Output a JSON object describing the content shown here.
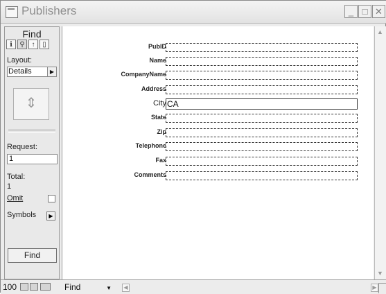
{
  "window": {
    "title": "Publishers",
    "icon": "document-icon"
  },
  "sidebar": {
    "heading": "Find",
    "mode_buttons": [
      "browse",
      "find",
      "layout",
      "preview"
    ],
    "layout_label": "Layout:",
    "layout_value": "Details",
    "request_label": "Request:",
    "request_value": "1",
    "total_label": "Total:",
    "total_value": "1",
    "omit_label": "Omit",
    "omit_checked": false,
    "symbols_label": "Symbols",
    "find_button": "Find"
  },
  "form": {
    "fields": [
      {
        "label": "PubID",
        "value": ""
      },
      {
        "label": "Name",
        "value": ""
      },
      {
        "label": "CompanyName",
        "value": ""
      },
      {
        "label": "Address",
        "value": ""
      },
      {
        "label": "City",
        "value": "CA"
      },
      {
        "label": "State",
        "value": ""
      },
      {
        "label": "Zip",
        "value": ""
      },
      {
        "label": "Telephone",
        "value": ""
      },
      {
        "label": "Fax",
        "value": ""
      },
      {
        "label": "Comments",
        "value": ""
      }
    ]
  },
  "statusbar": {
    "zoom": "100",
    "mode": "Find"
  }
}
